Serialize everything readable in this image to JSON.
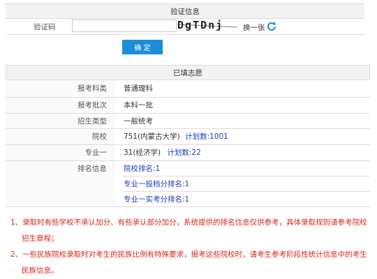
{
  "captcha": {
    "header": "验证信息",
    "label": "验证码",
    "input_value": "",
    "captcha_text": "DgTDnj",
    "refresh_label": "换一张",
    "confirm_button": "确  定"
  },
  "filled": {
    "header": "已填志愿",
    "rows": [
      {
        "label": "报考科类",
        "value": "普通理科",
        "extra": ""
      },
      {
        "label": "报考批次",
        "value": "本科一批",
        "extra": ""
      },
      {
        "label": "招生类型",
        "value": "一般统考",
        "extra": ""
      },
      {
        "label": "院校",
        "value": "751(内蒙古大学)",
        "extra": "计划数:1001"
      },
      {
        "label": "专业一",
        "value": "31(经济学)",
        "extra": "计划数:22"
      }
    ],
    "ranking_label": "排名信息",
    "ranking_items": [
      "院校排名:1",
      "专业一投档分排名:1",
      "专业一实考分排名:1"
    ]
  },
  "notes": [
    "1、录取时有些学校不承认加分、有些承认部分加分，系统提供的排名信息仅供参考，具体录取规则请参考院校",
    "招生章程；",
    "2、一些民族院校录取时对考生的民族比例有特殊要求，报考这些院校时，请考生参考阶段性统计信息中的考生",
    "民族信息。"
  ],
  "colors": {
    "accent": "#1a8fd8",
    "note": "#d8281c",
    "link": "#1a3fb5"
  }
}
